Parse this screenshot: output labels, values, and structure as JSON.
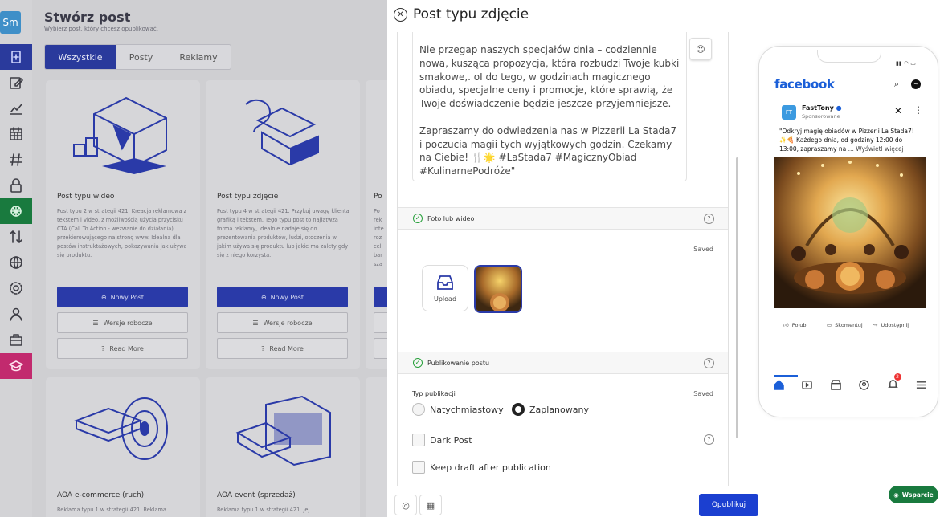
{
  "sidebar": {
    "logo": "Sm",
    "icons": [
      "new-post-icon",
      "edit-icon",
      "analytics-icon",
      "calendar-icon",
      "hashtag-icon",
      "lock-icon",
      "ai-icon",
      "transfer-icon",
      "globe-icon",
      "settings-icon",
      "user-icon",
      "briefcase-icon",
      "education-icon"
    ],
    "colors": {
      "active": "#2a3a9c",
      "ai": "#197a3e",
      "education": "#c22a6e"
    }
  },
  "background_page": {
    "title": "Stwórz post",
    "subtitle": "Wybierz post, który chcesz opublikować.",
    "filters": [
      "Wszystkie",
      "Posty",
      "Reklamy"
    ],
    "cards": [
      {
        "title": "Post typu wideo",
        "description": "Post typu 2 w strategii 421. Kreacja reklamowa z tekstem i video, z możliwością użycia przycisku CTA (Call To Action - wezwanie do działania) przekierowującego na stronę www. Idealna dla postów instruktażowych, pokazywania jak używa się produktu.",
        "new_label": "Nowy Post",
        "drafts_label": "Wersje robocze",
        "read_more_label": "Read More"
      },
      {
        "title": "Post typu zdjęcie",
        "description": "Post typu 4 w strategii 421. Przykuj uwagę klienta grafiką i tekstem. Tego typu post to najłatwza forma reklamy, idealnie nadaje się do prezentowania produktów, ludzi, otoczenia w jakim używa się produktu lub jakie ma zalety gdy się z niego korzysta.",
        "new_label": "Nowy Post",
        "drafts_label": "Wersje robocze",
        "read_more_label": "Read More"
      },
      {
        "title": "AOA e-commerce (ruch)",
        "description": "Reklama typu 1 w strategii 421. Reklama"
      },
      {
        "title": "AOA event (sprzedaż)",
        "description": "Reklama typu 1 w strategii 421. Jej"
      }
    ],
    "partial_card_text": [
      "Po",
      "Po",
      "rek",
      "inte",
      "roz",
      "cel",
      "bar",
      "sza"
    ]
  },
  "drawer": {
    "title": "Post typu zdjęcie",
    "post_text": "Nie przegap naszych specjałów dnia – codziennie nowa, kusząca propozycja, która rozbudzi Twoje kubki smakowe,. oI do tego, w godzinach magicznego obiadu, specjalne ceny i promocje, które sprawią, że Twoje doświadczenie będzie jeszcze przyjemniejsze.\n\nZapraszamy do odwiedzenia nas w Pizzerii La Stada7 i poczucia magii tych wyjątkowych godzin. Czekamy na Ciebie! 🍴🌟 #LaStada7 #MagicznyObiad #KulinarnePodróże\"",
    "media_section": {
      "title": "Foto lub wideo",
      "saved": "Saved",
      "upload_label": "Upload"
    },
    "publish_section": {
      "title": "Publikowanie postu",
      "saved": "Saved",
      "type_label": "Typ publikacji",
      "options": [
        "Natychmiastowy",
        "Zaplanowany"
      ],
      "selected": "Zaplanowany",
      "dark_post": "Dark Post",
      "keep_draft": "Keep draft after publication"
    },
    "publish_button": "Opublikuj"
  },
  "preview": {
    "brand": "facebook",
    "page_initials": "FT",
    "page_name": "FastTony",
    "sponsored": "Sponsorowane ·",
    "ad_text": "\"Odkryj magię obiadów w Pizzerii La Stada7! ✨🍕 Każdego dnia, od godziny 12:00 do 13:00, zapraszamy na",
    "see_more": "... Wyświetl więcej",
    "actions": [
      "Polub",
      "Skomentuj",
      "Udostępnij"
    ],
    "notification_count": "2",
    "brand_color": "#1b5fd8"
  },
  "support": {
    "label": "Wsparcie"
  }
}
